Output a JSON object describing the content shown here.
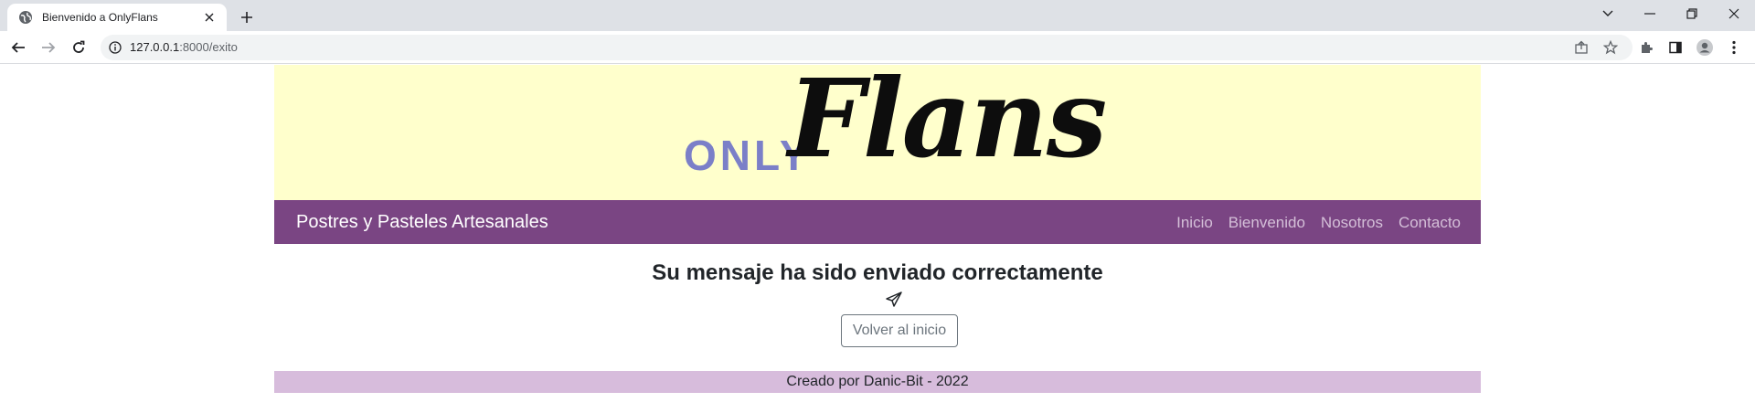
{
  "browser": {
    "tab_title": "Bienvenido a OnlyFlans",
    "url_host": "127.0.0.1",
    "url_path": ":8000/exito"
  },
  "site": {
    "logo_only": "ONLY",
    "logo_flans": "Flans",
    "brand": "Postres y Pasteles Artesanales",
    "nav": [
      "Inicio",
      "Bienvenido",
      "Nosotros",
      "Contacto"
    ],
    "message": "Su mensaje ha sido enviado correctamente",
    "back_button": "Volver al inicio",
    "footer": "Creado por Danic-Bit - 2022"
  },
  "colors": {
    "banner": "#ffffcc",
    "navbar": "#7a4583",
    "footer": "#d7bcdc",
    "logo_only": "#7b7fc8"
  }
}
